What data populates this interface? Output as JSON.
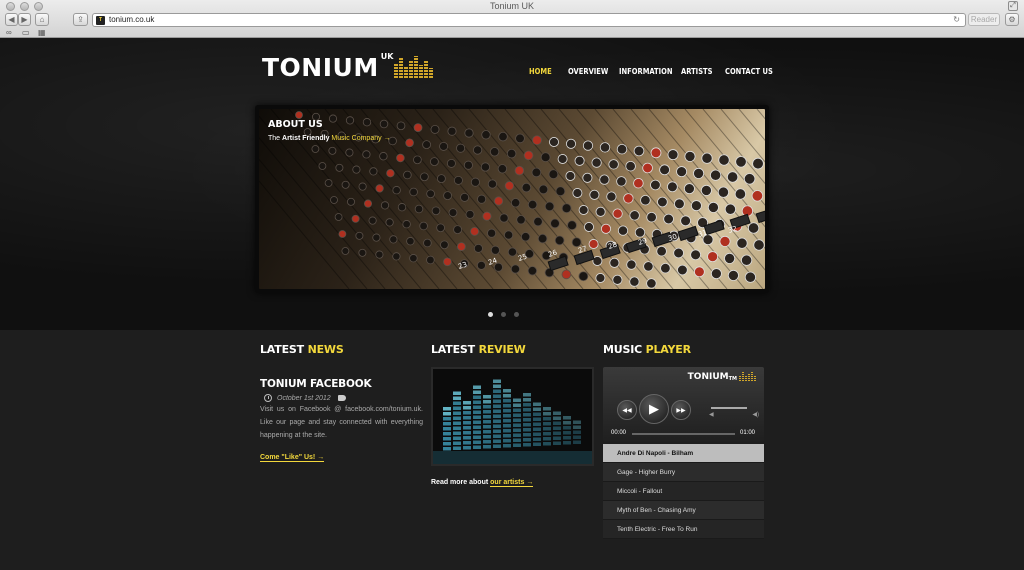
{
  "browser": {
    "window_title": "Tonium UK",
    "url": "tonium.co.uk",
    "reader_label": "Reader",
    "back_glyph": "◀",
    "forward_glyph": "▶",
    "home_glyph": "⌂",
    "share_glyph": "⇪",
    "reload_glyph": "↻",
    "fullscreen_glyph": "⤢",
    "bookmark_glyphs": [
      "∞",
      "▭",
      "▦"
    ]
  },
  "site": {
    "logo_text": "TONIUM",
    "logo_sup": "UK",
    "nav": [
      {
        "label": "HOME",
        "active": true
      },
      {
        "label": "OVERVIEW",
        "active": false
      },
      {
        "label": "INFORMATION",
        "active": false
      },
      {
        "label": "ARTISTS",
        "active": false
      },
      {
        "label": "CONTACT US",
        "active": false
      }
    ],
    "accent_color": "#f3d83c"
  },
  "slider": {
    "title": "ABOUT US",
    "subtitle_prefix": "The",
    "subtitle_bold": "Artist Friendly",
    "subtitle_highlight": "Music Company →",
    "channel_numbers": [
      "23",
      "24",
      "25",
      "26",
      "27",
      "28",
      "29",
      "30",
      "31",
      "32"
    ],
    "active_dot": 0,
    "dot_count": 3
  },
  "news": {
    "heading_white": "LATEST",
    "heading_yellow": "NEWS",
    "item_title": "TONIUM FACEBOOK",
    "date": "October 1st 2012",
    "body": "Visit us on Facebook @ facebook.com/tonium.uk. Like our page and stay connected with everything happening at the site.",
    "link": "Come \"Like\" Us! →"
  },
  "review": {
    "heading_white": "LATEST",
    "heading_yellow": "REVIEW",
    "more_prefix": "Read more about",
    "more_link": "our artists →"
  },
  "player": {
    "heading_white": "MUSIC",
    "heading_yellow": "PLAYER",
    "logo": "TONIUM",
    "logo_tm": "TM",
    "time_current": "00:00",
    "time_total": "01:00",
    "rewind_glyph": "◀◀",
    "play_glyph": "▶",
    "forward_glyph": "▶▶",
    "vol_low_glyph": "◀",
    "vol_high_glyph": "◀)",
    "tracks": [
      "Andre Di Napoli - Bilham",
      "Gage - Higher Burry",
      "Miccoli - Fallout",
      "Myth of Ben - Chasing Amy",
      "Tenth Electric - Free To Run"
    ],
    "current_track": 0
  }
}
